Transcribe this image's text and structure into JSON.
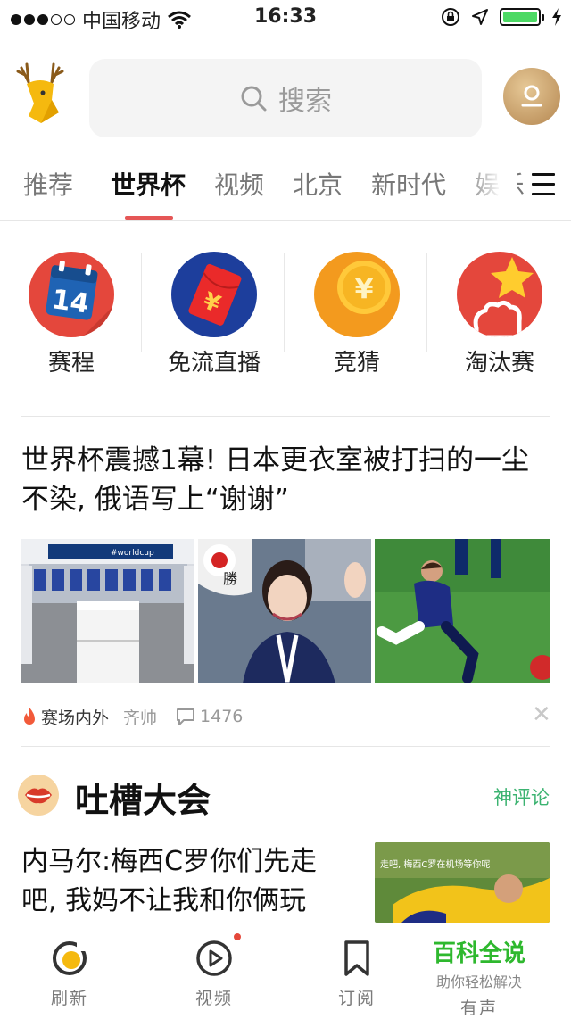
{
  "status_bar": {
    "carrier": "中国移动",
    "time": "16:33"
  },
  "header": {
    "search_label": "搜索"
  },
  "tabs": [
    {
      "label": "推荐",
      "active": false
    },
    {
      "label": "世界杯",
      "active": true
    },
    {
      "label": "视频",
      "active": false
    },
    {
      "label": "北京",
      "active": false
    },
    {
      "label": "新时代",
      "active": false
    },
    {
      "label": "娱乐",
      "active": false
    }
  ],
  "quick_links": [
    {
      "label": "赛程",
      "icon": "calendar-14-icon",
      "number": "14"
    },
    {
      "label": "免流直播",
      "icon": "red-envelope-icon",
      "symbol": "¥"
    },
    {
      "label": "竞猜",
      "icon": "gold-coin-icon",
      "symbol": "¥"
    },
    {
      "label": "淘汰赛",
      "icon": "star-trophy-icon"
    }
  ],
  "article": {
    "title": "世界杯震撼1幕! 日本更衣室被打扫的一尘不染, 俄语写上“谢谢”",
    "source": "赛场内外",
    "author": "齐帅",
    "comments": "1476",
    "thumb1_text": "#worldcup",
    "thumb2_text": "勝"
  },
  "roast": {
    "title": "吐槽大会",
    "link": "神评论",
    "text": "内马尔:梅西C罗你们先走吧, 我妈不让我和你俩玩",
    "thumb_caption": "走吧, 梅西C罗在机场等你呢"
  },
  "bottom_nav": [
    {
      "label": "刷新",
      "icon": "refresh-icon"
    },
    {
      "label": "视频",
      "icon": "play-icon"
    },
    {
      "label": "订阅",
      "icon": "bookmark-icon"
    },
    {
      "label": "有声",
      "icon": "audio-icon"
    }
  ],
  "ad": {
    "title": "百科全说",
    "subtitle": "助你轻松解决"
  }
}
